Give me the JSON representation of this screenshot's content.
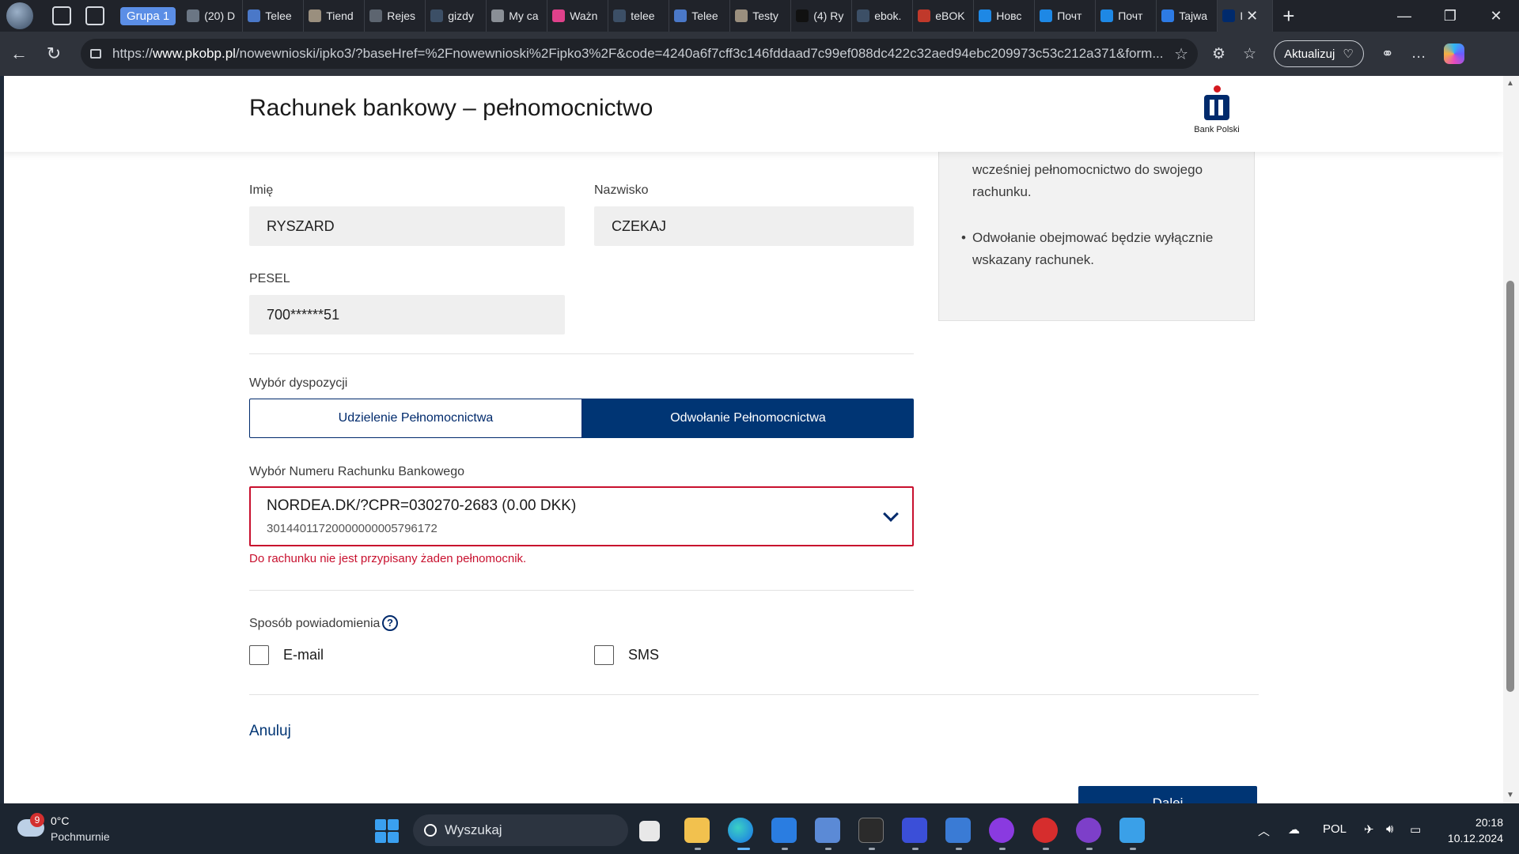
{
  "browser": {
    "tab_group": "Grupa 1",
    "tabs": [
      {
        "title": "(20) D",
        "color": "#6b7684"
      },
      {
        "title": "Telee",
        "color": "#4a78c8"
      },
      {
        "title": "Tiend",
        "color": "#9a8f7e"
      },
      {
        "title": "Rejes",
        "color": "#5d6570"
      },
      {
        "title": "gizdy",
        "color": "#3c4f66"
      },
      {
        "title": "My ca",
        "color": "#8a8f96"
      },
      {
        "title": "Ważn",
        "color": "#e0418b"
      },
      {
        "title": "telee",
        "color": "#3c4f66"
      },
      {
        "title": "Telee",
        "color": "#4a78c8"
      },
      {
        "title": "Testy",
        "color": "#9a8f7e"
      },
      {
        "title": "(4) Ry",
        "color": "#111111"
      },
      {
        "title": "ebok.",
        "color": "#3c4f66"
      },
      {
        "title": "eBOK",
        "color": "#c0392b"
      },
      {
        "title": "Новс",
        "color": "#1e88e5"
      },
      {
        "title": "Почт",
        "color": "#1e88e5"
      },
      {
        "title": "Почт",
        "color": "#1e88e5"
      },
      {
        "title": "Tajwa",
        "color": "#2d7be5"
      }
    ],
    "active_tab_title": "I",
    "url_prefix": "https://",
    "url_domain": "www.pkobp.pl",
    "url_rest": "/nowewnioski/ipko3/?baseHref=%2Fnowewnioski%2Fipko3%2F&code=4240a6f7cff3c146fddaad7c99ef088dc422c32aed94ebc209973c53c212a371&form...",
    "update_button": "Aktualizuj"
  },
  "page": {
    "title": "Rachunek bankowy – pełnomocnictwo",
    "logo_text": "Bank Polski",
    "first_name_label": "Imię",
    "first_name_value": "RYSZARD",
    "last_name_label": "Nazwisko",
    "last_name_value": "CZEKAJ",
    "pesel_label": "PESEL",
    "pesel_value": "700******51",
    "info_items": [
      "Możesz samodzielnie odwołać ustanowione wcześniej pełnomocnictwo do swojego rachunku.",
      "Odwołanie obejmować będzie wyłącznie wskazany rachunek."
    ],
    "disposition_label": "Wybór dyspozycji",
    "disposition_options": [
      "Udzielenie Pełnomocnictwa",
      "Odwołanie Pełnomocnictwa"
    ],
    "disposition_selected": "Odwołanie Pełnomocnictwa",
    "account_label": "Wybór Numeru Rachunku Bankowego",
    "account_main": "NORDEA.DK/?CPR=030270-2683 (0.00 DKK)",
    "account_number": "30144011720000000005796172",
    "account_error": "Do rachunku nie jest przypisany żaden pełnomocnik.",
    "notify_label": "Sposób powiadomienia",
    "notify_options": [
      {
        "label": "E-mail",
        "checked": false
      },
      {
        "label": "SMS",
        "checked": false
      }
    ],
    "cancel_link": "Anuluj",
    "next_button": "Dalej",
    "accent_color": "#003574",
    "error_color": "#c8102e"
  },
  "taskbar": {
    "weather_badge": "9",
    "weather_temp": "0°C",
    "weather_desc": "Pochmurnie",
    "search_placeholder": "Wyszukaj",
    "language": "POL",
    "time": "20:18",
    "date": "10.12.2024"
  }
}
